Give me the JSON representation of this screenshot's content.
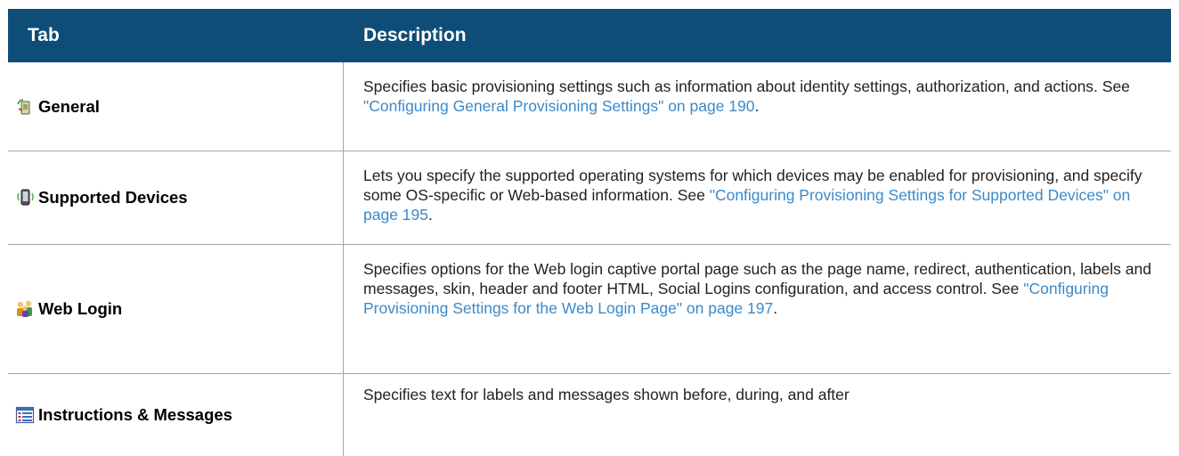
{
  "header": {
    "col_tab": "Tab",
    "col_description": "Description"
  },
  "rows": [
    {
      "tab": "General",
      "icon": "general-tab-icon",
      "desc_text": "Specifies basic provisioning settings such as information about identity settings, authorization, and actions. See ",
      "link_text": "\"Configuring General Provisioning Settings\" on page 190",
      "desc_end": "."
    },
    {
      "tab": "Supported Devices",
      "icon": "mobile-device-icon",
      "desc_text": "Lets you specify the supported operating systems for which devices may be enabled for provisioning, and specify some OS-specific or Web-based information. See ",
      "link_text": "\"Configuring Provisioning Settings for Supported Devices\" on page 195",
      "desc_end": "."
    },
    {
      "tab": "Web Login",
      "icon": "users-group-icon",
      "desc_text": "Specifies options for the Web login captive portal page such as the page name, redirect, authentication, labels and messages, skin, header and footer HTML, Social Logins configuration, and access control. See ",
      "link_text": "\"Configuring Provisioning Settings for the Web Login Page\" on page 197",
      "desc_end": "."
    },
    {
      "tab": "Instructions & Messages",
      "icon": "list-icon",
      "desc_text": "Specifies text for labels and messages shown before, during, and after",
      "link_text": "",
      "desc_end": ""
    }
  ],
  "colors": {
    "header_bg": "#0d4d78",
    "link": "#3c89c8"
  }
}
